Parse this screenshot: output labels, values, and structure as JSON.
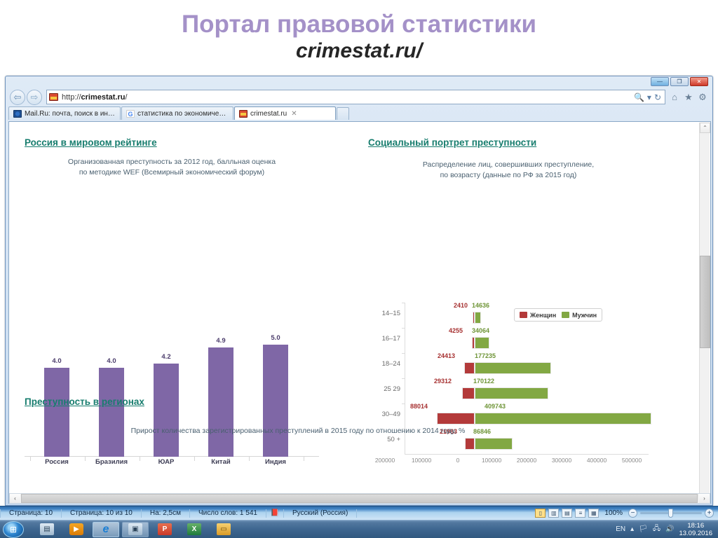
{
  "slide": {
    "title_main": "Портал правовой статистики",
    "title_sub": "crimestat.ru/"
  },
  "browser": {
    "window_buttons": {
      "minimize": "—",
      "maximize": "❐",
      "close": "✕"
    },
    "nav": {
      "back": "⇦",
      "forward": "⇨"
    },
    "address": {
      "protocol": "http://",
      "host": "crimestat.ru",
      "path": "/",
      "full": "http://crimestat.ru/"
    },
    "address_icons": {
      "search": "🔍",
      "dropdown": "▾",
      "refresh": "↻"
    },
    "toolbar_icons": {
      "home": "⌂",
      "favorites": "★",
      "settings": "⚙"
    },
    "tabs": [
      {
        "label": "Mail.Ru: почта, поиск в интер...",
        "favicon": "mail-ru-icon",
        "active": false
      },
      {
        "label": "статистика по экономическим...",
        "favicon": "google-icon",
        "active": false
      },
      {
        "label": "crimestat.ru",
        "favicon": "crimestat-icon",
        "active": true,
        "close": "✕"
      }
    ],
    "scrollbar": {
      "up": "⌃",
      "down": "⌄",
      "left": "‹",
      "right": "›"
    }
  },
  "page": {
    "sections": [
      {
        "heading": "Россия в мировом рейтинге"
      },
      {
        "heading": "Социальный портрет преступности"
      },
      {
        "heading": "Преступность в регионах"
      }
    ],
    "regions_caption": "Прирост количества зарегистрированных преступлений в 2015 году по отношению к 2014 году, %"
  },
  "chart_data": [
    {
      "type": "bar",
      "title": "Организованная преступность за 2012 год, балльная оценка\nпо методике WEF (Всемирный экономический форум)",
      "categories": [
        "Россия",
        "Бразилия",
        "ЮАР",
        "Китай",
        "Индия"
      ],
      "values": [
        4.0,
        4.2,
        4.2,
        4.9,
        5.0
      ],
      "value_labels": [
        "4.0",
        "4.0",
        "4.2",
        "4.9",
        "5.0"
      ],
      "xlabel": "",
      "ylabel": "",
      "ylim": [
        0,
        5.6
      ],
      "grid": false,
      "legend": "none",
      "bar_color": "#7f67a6"
    },
    {
      "type": "bar",
      "orientation": "tornado",
      "title": "Распределение лиц, совершивших преступление,\nпо возрасту (данные по РФ за 2015 год)",
      "categories": [
        "14–15",
        "16–17",
        "18–24",
        "25 29",
        "30–49",
        "50 +"
      ],
      "series": [
        {
          "name": "Женщин",
          "color": "#b33a3a",
          "values": [
            2410,
            4255,
            24413,
            29312,
            88014,
            21983
          ]
        },
        {
          "name": "Мужчин",
          "color": "#82a843",
          "values": [
            14636,
            34064,
            177235,
            170122,
            409743,
            86846
          ]
        }
      ],
      "xticks": [
        "200000",
        "100000",
        "0",
        "100000",
        "200000",
        "300000",
        "400000",
        "500000"
      ],
      "xlim": [
        -200000,
        500000
      ],
      "legend_position": "top-right",
      "grid": false
    }
  ],
  "statusbar": {
    "page": "Страница: 10",
    "page_of": "Страница: 10 из 10",
    "position": "На: 2,5см",
    "words": "Число слов: 1 541",
    "spell_icon": "spellcheck-icon",
    "language": "Русский (Россия)",
    "view_icons": [
      "print-layout-icon",
      "full-reading-icon",
      "web-layout-icon",
      "outline-icon",
      "draft-icon"
    ],
    "zoom": "100%",
    "zoom_out": "−",
    "zoom_in": "+"
  },
  "taskbar": {
    "start": "start-orb-icon",
    "items": [
      {
        "name": "media-center-icon",
        "glyph": "▤"
      },
      {
        "name": "media-player-icon",
        "glyph": "▶"
      },
      {
        "name": "internet-explorer-icon",
        "glyph": "e"
      },
      {
        "name": "window-icon",
        "glyph": "▣"
      },
      {
        "name": "powerpoint-icon",
        "glyph": "P"
      },
      {
        "name": "excel-icon",
        "glyph": "X"
      },
      {
        "name": "explorer-icon",
        "glyph": "▭"
      }
    ],
    "tray": {
      "language": "EN",
      "show_hidden": "▴",
      "icons": [
        "action-center-icon",
        "network-icon",
        "volume-icon"
      ],
      "time": "18:16",
      "date": "13.09.2016"
    }
  }
}
